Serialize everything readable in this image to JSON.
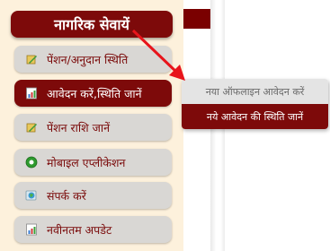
{
  "header": {
    "title": "नागरिक सेवायें"
  },
  "menu": {
    "items": [
      {
        "label": "पेंशन/अनुदान स्थिति",
        "icon": "pencil-notepad-icon"
      },
      {
        "label": "आवेदन करें,स्थिति जानें",
        "icon": "document-chart-icon"
      },
      {
        "label": "पेंशन राशि जानें",
        "icon": "pencil-notepad-icon"
      },
      {
        "label": "मोबाइल एप्लीकेशन",
        "icon": "green-circle-icon"
      },
      {
        "label": "संपर्क करें",
        "icon": "contact-globe-icon"
      },
      {
        "label": "नवीनतम अपडेट",
        "icon": "document-chart-icon"
      }
    ]
  },
  "dropdown": {
    "items": [
      {
        "label": "नया ऑफलाइन आवेदन करें"
      },
      {
        "label": "नये आवेदन की स्थिति जानें"
      }
    ]
  },
  "colors": {
    "accent": "#7d0a0a",
    "panel": "#fdf1dc",
    "item": "#d9d7d4",
    "arrow": "#e8141b"
  }
}
